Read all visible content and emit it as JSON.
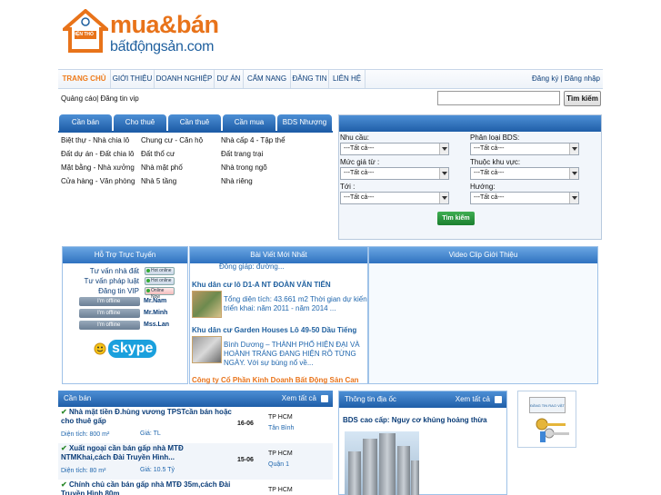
{
  "logo": {
    "title": "mua&bán",
    "subtitle": "bấtđộngsản.com",
    "house_text": "DIỆN THỔ"
  },
  "menu": {
    "items": [
      "TRANG CHỦ",
      "GIỚI THIỆU",
      "DOANH NGHIỆP",
      "DỰ ÁN",
      "CẨM NANG",
      "ĐĂNG TIN",
      "LIÊN HỆ"
    ],
    "auth": "Đăng ký | Đăng nhập"
  },
  "search": {
    "ads_label": "Quảng cáo| Đăng tin vip",
    "button": "Tìm kiếm"
  },
  "category_tabs": [
    "Cần bán",
    "Cho thuê",
    "Cần thuê",
    "Cần mua",
    "BDS Nhượng"
  ],
  "category_links": [
    [
      "Biệt thự - Nhà chia lô",
      "Chung cư - Căn hộ",
      "Nhà cấp 4 - Tập thể"
    ],
    [
      "Đất dự án - Đất chia lô",
      "Đất thổ cư",
      "Đất trang trại"
    ],
    [
      "Mặt bằng - Nhà xưởng",
      "Nhà mặt phố",
      "Nhà trong ngõ"
    ],
    [
      "Cửa hàng - Văn phòng",
      "Nhà 5 tầng",
      "Nhà riêng"
    ]
  ],
  "filter": {
    "labels": [
      "Nhu cầu:",
      "Phân loại BDS:",
      "Mức giá từ :",
      "Thuộc khu vực:",
      "Tới :",
      "Hướng:"
    ],
    "select_value": "---Tất cả---",
    "button": "Tìm kiếm"
  },
  "support": {
    "title": "Hỗ Trợ Trực Tuyến",
    "lines": [
      "Tư vấn nhà đất",
      "Tư vấn pháp luật",
      "Đăng tin VIP"
    ],
    "statuses": [
      "Hot online",
      "Hot online",
      "Online Now"
    ],
    "offline_label": "I'm offline",
    "offline_names": [
      "Mr.Nam",
      "Mr.Minh",
      "Mss.Lan"
    ],
    "skype": "skype"
  },
  "news": {
    "title": "Bài Viết Mới Nhất",
    "top_fragment": "Đồng giáp: đường...",
    "items": [
      {
        "title": "Khu dân cư lô D1-A NT ĐOÀN VĂN TIẾN",
        "body": "Tổng diện tích: 43.661 m2 Thời gian dự kiến triển khai: năm 2011 - năm 2014 ..."
      },
      {
        "title": "Khu dân cư Garden Houses Lô 49-50 Dầu Tiếng",
        "body": "Bình Dương – THÀNH PHỐ HIỆN ĐẠI VÀ HOÀNH TRÁNG ĐANG HIỆN RÕ TỪNG NGÀY. Với sự bùng nổ về..."
      },
      {
        "title": "Công ty Cổ Phần Kinh Doanh Bất Động Sản Can",
        "body": ""
      }
    ]
  },
  "video": {
    "title": "Video Clip Giới Thiệu"
  },
  "listing": {
    "title": "Cần bán",
    "see_all": "Xem tất cả",
    "rows": [
      {
        "title": "Nhà mặt tiền Đ.hùng vương TPSTcần bán hoặc cho thuê gấp",
        "meta": "Diện tích: 800 m²",
        "price": "Giá: TL",
        "date": "16-06",
        "city": "TP HCM",
        "district": "Tân Bình"
      },
      {
        "title": "Xuất ngoại cần bán gấp nhà MTĐ NTMKhai,cách Đài Truyền Hình...",
        "meta": "Diện tích: 80 m²",
        "price": "Giá: 10.5 Tỷ",
        "date": "15-06",
        "city": "TP HCM",
        "district": "Quận 1"
      },
      {
        "title": "Chính chủ cần bán gấp nhà MTĐ 35m,cách Đài Truyền Hình 80m",
        "meta": "",
        "price": "",
        "date": "",
        "city": "TP HCM",
        "district": ""
      }
    ]
  },
  "info": {
    "title": "Thông tin địa ốc",
    "see_all": "Xem tất cả",
    "headline": "BDS cao cấp: Nguy cơ khủng hoảng thừa"
  },
  "ad": {
    "label": "ĐĂNG TIN RAO VẶT"
  },
  "colors": {
    "brand_orange": "#e8731a",
    "brand_blue": "#1f5ea8",
    "link_blue": "#0b3d78"
  }
}
